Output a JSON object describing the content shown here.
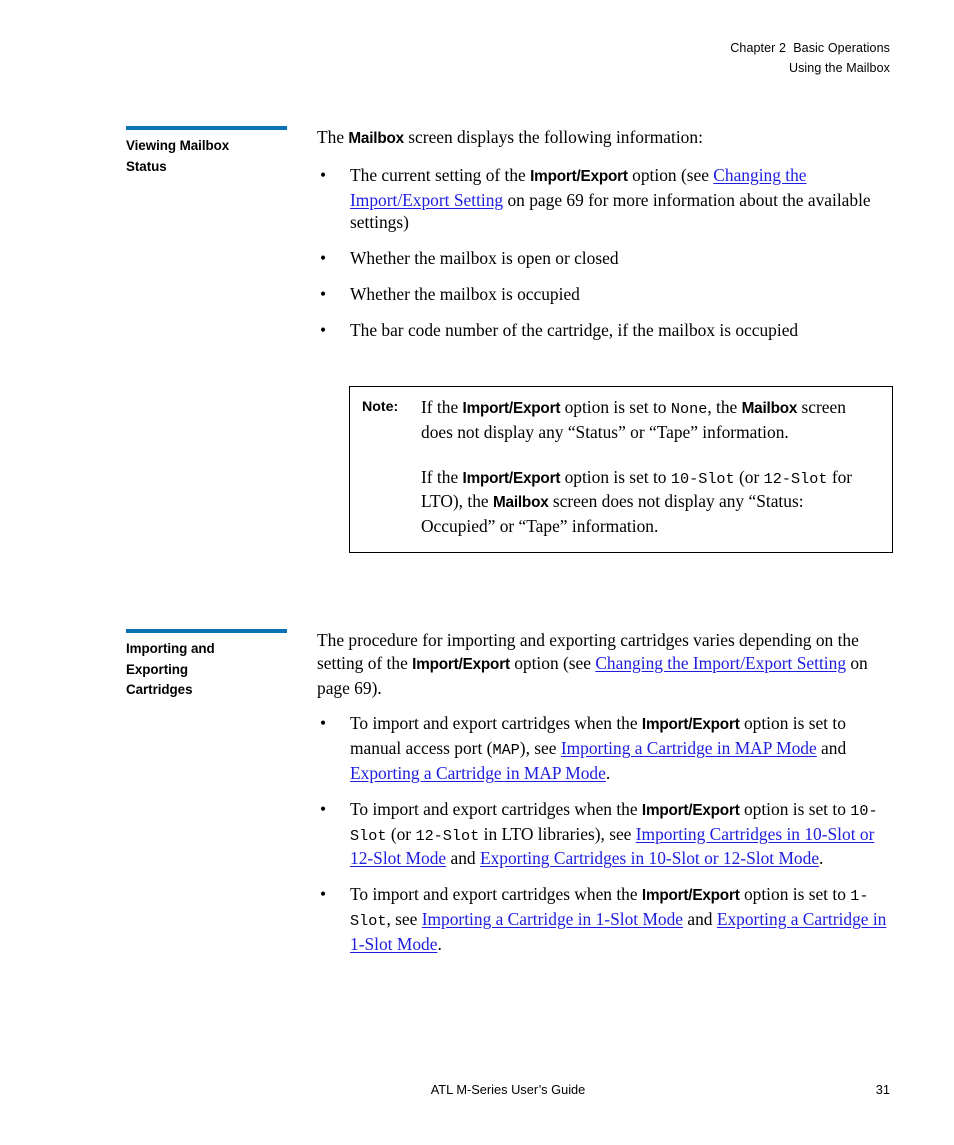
{
  "header": {
    "line1": "Chapter 2  Basic Operations",
    "line2": "Using the Mailbox"
  },
  "section1": {
    "heading_line1": "Viewing Mailbox",
    "heading_line2": "Status",
    "intro_pre": "The ",
    "intro_bold": "Mailbox",
    "intro_post": " screen displays the following information:",
    "bullets": [
      {
        "marker": "•",
        "p1": "The current setting of the ",
        "b1": "Import/Export",
        "p2": " option (see ",
        "link1": "Changing the Import/Export Setting",
        "p3": " on page 69 for more information about the available settings)"
      },
      {
        "marker": "•",
        "p1": "Whether the mailbox is open or closed"
      },
      {
        "marker": "•",
        "p1": "Whether the mailbox is occupied"
      },
      {
        "marker": "•",
        "p1": "The bar code number of the cartridge, if the mailbox is occupied"
      }
    ]
  },
  "note": {
    "label": "Note:",
    "para1_a": "If the ",
    "para1_b1": "Import/Export",
    "para1_b": " option is set to ",
    "para1_mono1": "None",
    "para1_c": ", the ",
    "para1_b2": "Mailbox",
    "para1_d": " screen does not display any “Status” or “Tape” information.",
    "para2_a": "If the ",
    "para2_b1": "Import/Export",
    "para2_b": " option is set to ",
    "para2_mono1": "10-Slot",
    "para2_c": " (or ",
    "para2_mono2": "12-Slot",
    "para2_d": " for LTO), the ",
    "para2_b2": "Mailbox",
    "para2_e": " screen does not display any “Status: Occupied” or “Tape” information."
  },
  "section2": {
    "heading_line1": "Importing and",
    "heading_line2": "Exporting",
    "heading_line3": "Cartridges",
    "intro_a": "The procedure for importing and exporting cartridges varies depending on the setting of the ",
    "intro_b": "Import/Export",
    "intro_c": " option (see ",
    "intro_link": "Changing the Import/Export Setting",
    "intro_d": " on page 69).",
    "bullets": [
      {
        "marker": "•",
        "p1": "To import and export cartridges when the ",
        "b1": "Import/Export",
        "p2": " option is set to manual access port (",
        "mono1": "MAP",
        "p3": "), see ",
        "link1": "Importing a Cartridge in MAP Mode",
        "p4": " and ",
        "link2": "Exporting a Cartridge in MAP Mode",
        "p5": "."
      },
      {
        "marker": "•",
        "p1": "To import and export cartridges when the ",
        "b1": "Import/Export",
        "p2": " option is set to ",
        "mono1": "10-Slot",
        "p3": " (or ",
        "mono2": "12-Slot",
        "p4": " in LTO libraries), see ",
        "link1": "Importing Cartridges in 10-Slot or 12-Slot Mode",
        "p5": " and ",
        "link2": "Exporting Cartridges in 10-Slot or 12-Slot Mode",
        "p6": "."
      },
      {
        "marker": "•",
        "p1": "To import and export cartridges when the ",
        "b1": "Import/Export",
        "p2": " option is set to ",
        "mono1": "1-Slot",
        "p3": ", see ",
        "link1": "Importing a Cartridge in 1-Slot Mode",
        "p4": " and ",
        "link2": "Exporting a Cartridge in 1-Slot Mode",
        "p5": "."
      }
    ]
  },
  "footer": {
    "title": "ATL M-Series User’s Guide",
    "page": "31"
  },
  "colors": {
    "rule_blue": "#0b72b5",
    "link_blue": "#1d1de0",
    "text_black": "#000000",
    "page_background": "#ffffff"
  }
}
